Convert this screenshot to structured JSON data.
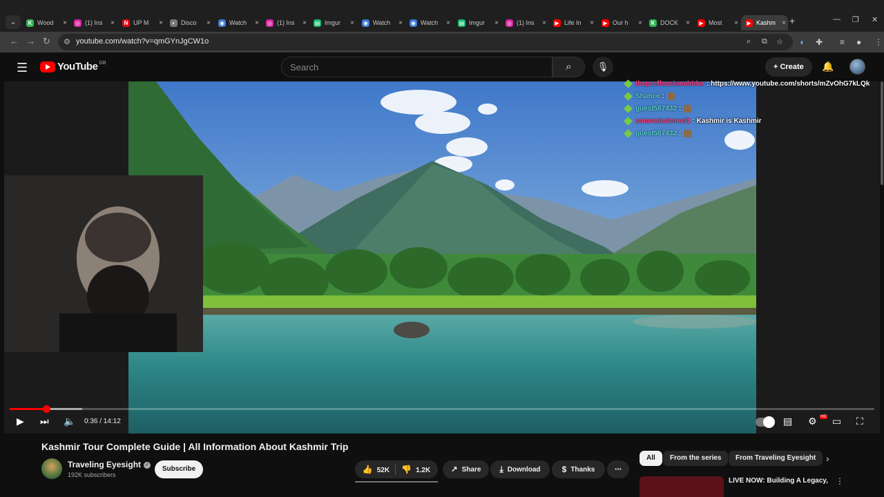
{
  "browser": {
    "tabs": [
      {
        "label": "Wood",
        "fav_text": "K",
        "fav_color": "#2fb457"
      },
      {
        "label": "(1) Ins",
        "fav_text": "◎",
        "fav_color": "#d6249f"
      },
      {
        "label": "UP M",
        "fav_text": "N",
        "fav_color": "#e50914"
      },
      {
        "label": "Disco",
        "fav_text": "◐",
        "fav_color": "#777777"
      },
      {
        "label": "Watch",
        "fav_text": "◉",
        "fav_color": "#3a7bd5"
      },
      {
        "label": "(1) Ins",
        "fav_text": "◎",
        "fav_color": "#d6249f"
      },
      {
        "label": "Imgur",
        "fav_text": "▤",
        "fav_color": "#1bb76e"
      },
      {
        "label": "Watch",
        "fav_text": "◉",
        "fav_color": "#3a7bd5"
      },
      {
        "label": "Watch",
        "fav_text": "◉",
        "fav_color": "#3a7bd5"
      },
      {
        "label": "Imgur",
        "fav_text": "▤",
        "fav_color": "#1bb76e"
      },
      {
        "label": "(1) Ins",
        "fav_text": "◎",
        "fav_color": "#d6249f"
      },
      {
        "label": "Life In",
        "fav_text": "▶",
        "fav_color": "#ff0000"
      },
      {
        "label": "Our h",
        "fav_text": "▶",
        "fav_color": "#ff0000"
      },
      {
        "label": "DOCK",
        "fav_text": "K",
        "fav_color": "#2fb457"
      },
      {
        "label": "Most",
        "fav_text": "▶",
        "fav_color": "#ff0000"
      },
      {
        "label": "Kashm",
        "fav_text": "▶",
        "fav_color": "#ff0000"
      }
    ],
    "new_tab": "+",
    "url": "youtube.com/watch?v=qmGYnJgCW1o"
  },
  "youtube": {
    "logo_text": "YouTube",
    "region": "GB",
    "search_placeholder": "Search",
    "create_label": "Create"
  },
  "chat": [
    {
      "user": "theproffessionalrider",
      "text": ": https://www.youtube.com/shorts/mZvOhG7kLQk",
      "user_color": "pink"
    },
    {
      "user": "Shance",
      "text": ":",
      "user_color": "cyan"
    },
    {
      "user": "guest567432",
      "text": ":",
      "user_color": "cyan"
    },
    {
      "user": "comradeahmed1",
      "text": ": Kashmir is Kashmir",
      "user_color": "pink"
    },
    {
      "user": "guest567432",
      "text": ":",
      "user_color": "cyan"
    }
  ],
  "player": {
    "current_time": "0:36",
    "duration": "14:12",
    "time_display": "0:36 / 14:12",
    "progress_fraction": 0.042,
    "buffered_fraction": 0.084
  },
  "video": {
    "title": "Kashmir Tour Complete Guide | All Information About Kashmir Trip",
    "channel": "Traveling Eyesight",
    "subscribers": "192K subscribers",
    "subscribe_label": "Subscribe",
    "likes": "52K",
    "dislikes": "1.2K",
    "share_label": "Share",
    "download_label": "Download",
    "thanks_label": "Thanks"
  },
  "sidebar": {
    "chips": [
      "All",
      "From the series",
      "From Traveling Eyesight"
    ],
    "recommended_title": "LIVE NOW: Building A Legacy,"
  },
  "colors": {
    "accent": "#ff0000",
    "background": "#0f0f0f"
  }
}
